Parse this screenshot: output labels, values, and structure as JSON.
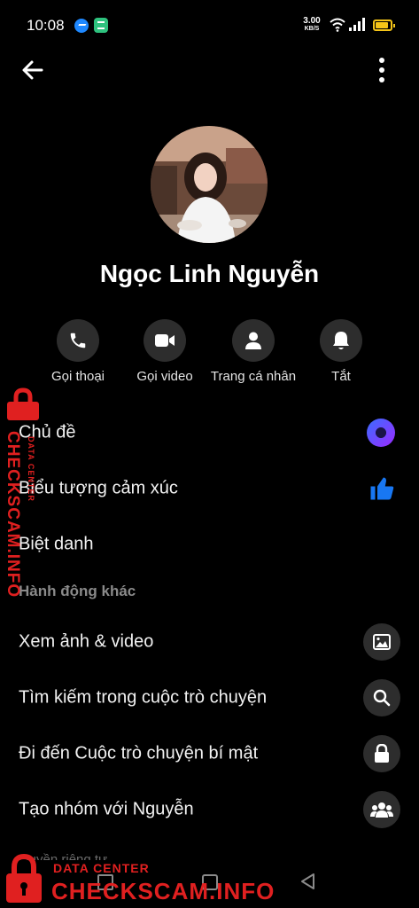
{
  "status_bar": {
    "time": "10:08",
    "net_speed": "3.00",
    "net_speed_unit": "KB/S",
    "icons": [
      "messenger-notification-icon",
      "app-notification-icon",
      "wifi-icon",
      "signal-icon",
      "battery-icon"
    ]
  },
  "header": {
    "back_icon": "arrow-left-icon",
    "more_icon": "more-vertical-icon"
  },
  "profile": {
    "name": "Ngọc Linh Nguyễn"
  },
  "actions": [
    {
      "label": "Gọi thoại",
      "icon": "phone-icon"
    },
    {
      "label": "Gọi video",
      "icon": "video-camera-icon"
    },
    {
      "label": "Trang cá nhân",
      "icon": "person-icon"
    },
    {
      "label": "Tắt",
      "icon": "bell-icon"
    }
  ],
  "customize": [
    {
      "label": "Chủ đề",
      "icon": "theme-gradient-icon"
    },
    {
      "label": "Biểu tượng cảm xúc",
      "icon": "thumbs-up-icon"
    },
    {
      "label": "Biệt danh"
    }
  ],
  "more_actions": {
    "header": "Hành động khác",
    "items": [
      {
        "label": "Xem ảnh & video",
        "icon": "image-icon"
      },
      {
        "label": "Tìm kiếm trong cuộc trò chuyện",
        "icon": "search-icon"
      },
      {
        "label": "Đi đến Cuộc trò chuyện bí mật",
        "icon": "lock-icon"
      },
      {
        "label": "Tạo nhóm với Nguyễn",
        "icon": "group-icon"
      }
    ]
  },
  "privacy_header": "Quyền riêng tư",
  "watermark": {
    "sub": "DATA CENTER",
    "text": "CHECKSCAM.INFO"
  },
  "colors": {
    "background": "#000000",
    "icon_circle": "#2d2d2d",
    "accent_blue": "#1877f2",
    "watermark_red": "#e02020",
    "battery": "#f5c518"
  }
}
